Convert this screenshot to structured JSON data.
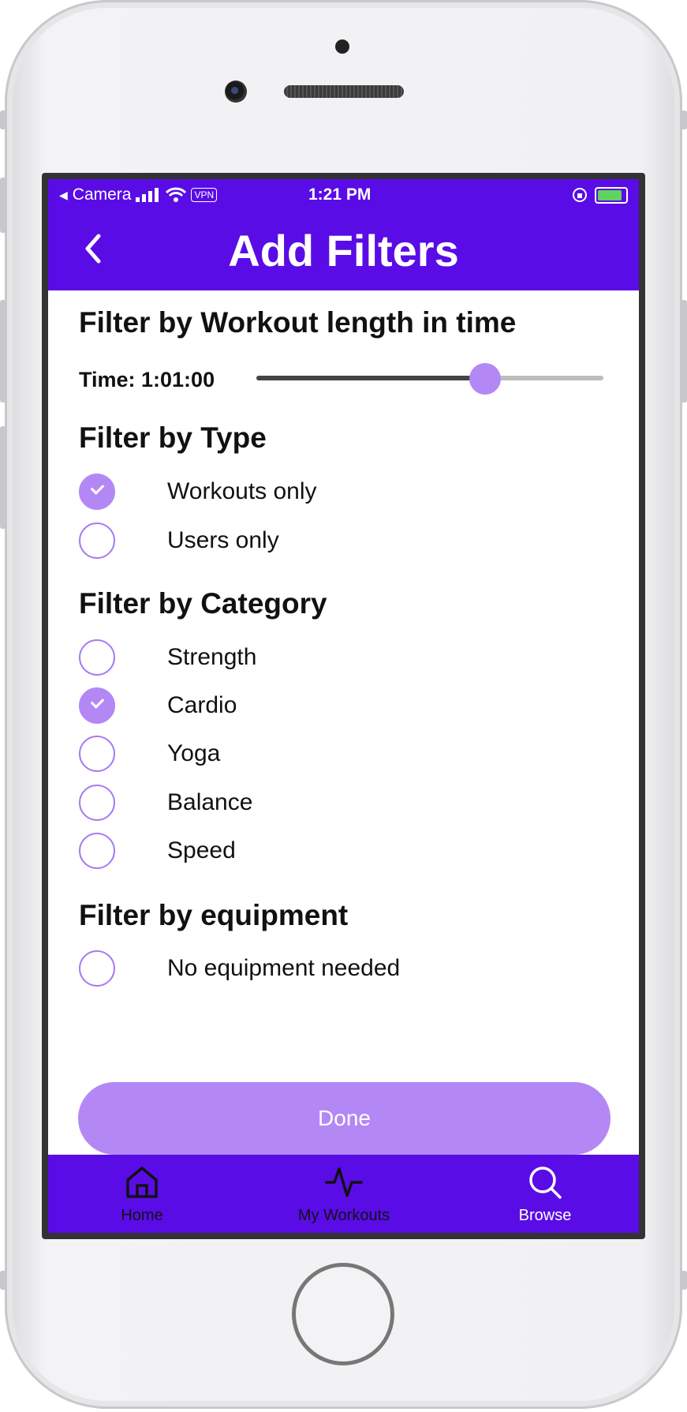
{
  "status_bar": {
    "carrier": "Camera",
    "vpn": "VPN",
    "time": "1:21 PM"
  },
  "header": {
    "title": "Add Filters",
    "back_icon": "chevron-left-icon"
  },
  "time_filter": {
    "heading": "Filter by Workout length in time",
    "label": "Time: 1:01:00",
    "slider_value_fraction": 0.66
  },
  "type_filter": {
    "heading": "Filter by Type",
    "options": [
      {
        "label": "Workouts only",
        "checked": true
      },
      {
        "label": "Users only",
        "checked": false
      }
    ]
  },
  "category_filter": {
    "heading": "Filter by Category",
    "options": [
      {
        "label": "Strength",
        "checked": false
      },
      {
        "label": "Cardio",
        "checked": true
      },
      {
        "label": "Yoga",
        "checked": false
      },
      {
        "label": "Balance",
        "checked": false
      },
      {
        "label": "Speed",
        "checked": false
      }
    ]
  },
  "equipment_filter": {
    "heading": "Filter by equipment",
    "options": [
      {
        "label": "No equipment needed",
        "checked": false
      }
    ]
  },
  "done_label": "Done",
  "tabs": [
    {
      "label": "Home",
      "icon": "home-icon",
      "color": "#111111"
    },
    {
      "label": "My Workouts",
      "icon": "activity-icon",
      "color": "#111111"
    },
    {
      "label": "Browse",
      "icon": "search-icon",
      "color": "#ffffff"
    }
  ],
  "colors": {
    "accent": "#5a0ce6",
    "selected": "#b388f5"
  }
}
